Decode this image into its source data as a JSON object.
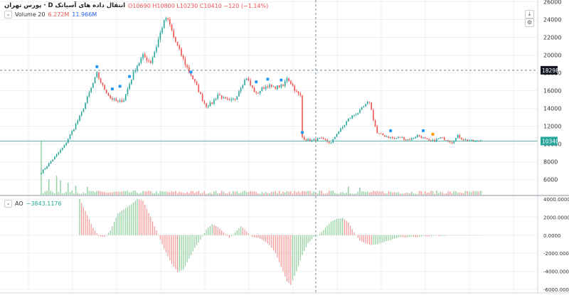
{
  "legend": {
    "title": "پورس تهران · D  انتقال داده های آسیاتک",
    "ohlc": "O10690  H10800  L10230  C10410  −120 (−1.14%)",
    "volume_label": "Volume 20",
    "volume_value": "6.272M",
    "volume_ma": "11.966M",
    "ao_label": "AO",
    "ao_value": "−3843.1176"
  },
  "toolbar": {
    "scroll_icon": "arrow-down-to-line-icon",
    "settings_icon": "settings-icon"
  },
  "colors": {
    "up": "#26a69a",
    "down": "#ef5350",
    "up_vol": "#9fd3ac",
    "down_vol": "#f5a6a6",
    "ao_up": "#8fce9b",
    "ao_down": "#f19595",
    "grid": "#eef0f3",
    "axis_text": "#333333"
  },
  "chart_data": [
    {
      "type": "candlestick",
      "title": "پورس تهران · D  انتقال داده های آسیاتک",
      "y_ticks": [
        6000,
        8000,
        10000,
        12000,
        14000,
        16000,
        18000,
        20000,
        22000,
        24000,
        26000
      ],
      "ylim": [
        4300,
        26200
      ],
      "price_labels": [
        {
          "value": 18298,
          "text": "18298",
          "color": "#131722"
        },
        {
          "value": 10340,
          "text": "10340",
          "color": "#26a69a"
        }
      ],
      "anchors": [
        [
          0,
          6800
        ],
        [
          6,
          8300
        ],
        [
          12,
          9800
        ],
        [
          17,
          11800
        ],
        [
          21,
          13500
        ],
        [
          24,
          15200
        ],
        [
          27,
          16800
        ],
        [
          29,
          17900
        ],
        [
          32,
          16500
        ],
        [
          36,
          15200
        ],
        [
          40,
          14700
        ],
        [
          43,
          15000
        ],
        [
          46,
          16800
        ],
        [
          49,
          18500
        ],
        [
          53,
          19900
        ],
        [
          57,
          19200
        ],
        [
          60,
          21000
        ],
        [
          63,
          23200
        ],
        [
          65,
          24200
        ],
        [
          67,
          23400
        ],
        [
          69,
          22000
        ],
        [
          71,
          21000
        ],
        [
          73,
          20000
        ],
        [
          75,
          19000
        ],
        [
          78,
          17800
        ],
        [
          81,
          16500
        ],
        [
          84,
          15000
        ],
        [
          86,
          14300
        ],
        [
          89,
          14600
        ],
        [
          92,
          15600
        ],
        [
          95,
          15100
        ],
        [
          98,
          14800
        ],
        [
          101,
          15100
        ],
        [
          104,
          16500
        ],
        [
          107,
          17500
        ],
        [
          109,
          16600
        ],
        [
          112,
          15600
        ],
        [
          115,
          16200
        ],
        [
          118,
          16600
        ],
        [
          121,
          16300
        ],
        [
          124,
          16500
        ],
        [
          126,
          16500
        ],
        [
          128,
          17500
        ],
        [
          130,
          16900
        ],
        [
          133,
          15800
        ],
        [
          135,
          15400
        ],
        [
          136,
          10800
        ],
        [
          138,
          10500
        ],
        [
          141,
          10400
        ],
        [
          145,
          10600
        ],
        [
          148,
          10400
        ],
        [
          151,
          10100
        ],
        [
          154,
          11200
        ],
        [
          157,
          11900
        ],
        [
          160,
          12800
        ],
        [
          163,
          13300
        ],
        [
          166,
          13700
        ],
        [
          168,
          14200
        ],
        [
          170,
          14600
        ],
        [
          171,
          14800
        ],
        [
          173,
          12800
        ],
        [
          175,
          11200
        ],
        [
          178,
          11000
        ],
        [
          181,
          10800
        ],
        [
          184,
          10600
        ],
        [
          187,
          10800
        ],
        [
          190,
          10500
        ],
        [
          193,
          10600
        ],
        [
          196,
          11000
        ],
        [
          199,
          10700
        ],
        [
          202,
          10300
        ],
        [
          205,
          10400
        ],
        [
          208,
          10700
        ],
        [
          211,
          10500
        ],
        [
          214,
          10200
        ],
        [
          217,
          10900
        ],
        [
          220,
          10500
        ],
        [
          223,
          10400
        ],
        [
          226,
          10300
        ],
        [
          229,
          10400
        ]
      ],
      "icon_markers": [
        {
          "index": 29,
          "price": 18700,
          "color": "#2196f3"
        },
        {
          "index": 37,
          "price": 16200,
          "color": "#2196f3"
        },
        {
          "index": 41,
          "price": 16500,
          "color": "#2196f3"
        },
        {
          "index": 46,
          "price": 17600,
          "color": "#2196f3"
        },
        {
          "index": 78,
          "price": 18100,
          "color": "#2196f3"
        },
        {
          "index": 112,
          "price": 17000,
          "color": "#2196f3"
        },
        {
          "index": 118,
          "price": 17300,
          "color": "#2196f3"
        },
        {
          "index": 125,
          "price": 17200,
          "color": "#2196f3"
        },
        {
          "index": 136,
          "price": 11300,
          "color": "#2196f3"
        },
        {
          "index": 182,
          "price": 11500,
          "color": "#2196f3"
        },
        {
          "index": 199,
          "price": 11500,
          "color": "#2196f3"
        },
        {
          "index": 204,
          "price": 11100,
          "color": "#ff9800"
        }
      ],
      "grid": true,
      "crosshair": {
        "index": 143,
        "price": 18298
      }
    },
    {
      "type": "bar",
      "title": "Volume 20",
      "spikes": [
        {
          "index": 0,
          "value": 9
        },
        {
          "index": 4,
          "value": 2.6
        },
        {
          "index": 8,
          "value": 3.2
        },
        {
          "index": 10,
          "value": 2.4
        },
        {
          "index": 14,
          "value": 2.0
        },
        {
          "index": 18,
          "value": 1.5
        },
        {
          "index": 24,
          "value": 1.3
        },
        {
          "index": 160,
          "value": 1.4
        },
        {
          "index": 166,
          "value": 1.2
        }
      ]
    },
    {
      "type": "bar",
      "title": "AO",
      "y_ticks": [
        4000,
        2000,
        0,
        -2000,
        -4000,
        -6000
      ],
      "y_tick_labels": [
        "4000.0000",
        "2000.0000",
        "0.0000",
        "-2000.0000",
        "-4000.0000",
        "-6000.0000"
      ],
      "ylim": [
        -6300,
        4300
      ],
      "anchors": [
        [
          20,
          4000
        ],
        [
          24,
          2200
        ],
        [
          27,
          800
        ],
        [
          30,
          -100
        ],
        [
          33,
          -200
        ],
        [
          36,
          500
        ],
        [
          40,
          2400
        ],
        [
          44,
          3000
        ],
        [
          47,
          3400
        ],
        [
          50,
          4000
        ],
        [
          53,
          3800
        ],
        [
          57,
          2000
        ],
        [
          60,
          500
        ],
        [
          64,
          -1500
        ],
        [
          68,
          -3200
        ],
        [
          71,
          -4100
        ],
        [
          74,
          -3800
        ],
        [
          77,
          -2600
        ],
        [
          80,
          -1400
        ],
        [
          83,
          -500
        ],
        [
          86,
          600
        ],
        [
          89,
          1200
        ],
        [
          92,
          900
        ],
        [
          95,
          300
        ],
        [
          98,
          -300
        ],
        [
          101,
          300
        ],
        [
          104,
          1000
        ],
        [
          107,
          400
        ],
        [
          110,
          -200
        ],
        [
          113,
          -300
        ],
        [
          116,
          -600
        ],
        [
          119,
          -1100
        ],
        [
          122,
          -2000
        ],
        [
          125,
          -3500
        ],
        [
          128,
          -5100
        ],
        [
          130,
          -5500
        ],
        [
          133,
          -4000
        ],
        [
          136,
          -2200
        ],
        [
          139,
          -900
        ],
        [
          142,
          -200
        ],
        [
          145,
          100
        ],
        [
          148,
          800
        ],
        [
          151,
          1500
        ],
        [
          154,
          1800
        ],
        [
          157,
          1900
        ],
        [
          160,
          1400
        ],
        [
          163,
          300
        ],
        [
          166,
          -600
        ],
        [
          169,
          -900
        ],
        [
          172,
          -1100
        ],
        [
          175,
          -1000
        ],
        [
          178,
          -800
        ],
        [
          181,
          -600
        ],
        [
          184,
          -400
        ],
        [
          187,
          -200
        ],
        [
          190,
          -300
        ],
        [
          193,
          -150
        ],
        [
          196,
          -250
        ],
        [
          199,
          -100
        ],
        [
          202,
          -150
        ],
        [
          205,
          -50
        ],
        [
          208,
          -100
        ],
        [
          211,
          -50
        ],
        [
          214,
          0
        ],
        [
          217,
          0
        ],
        [
          220,
          0
        ],
        [
          223,
          0
        ],
        [
          226,
          0
        ],
        [
          229,
          0
        ]
      ],
      "grid": true,
      "crosshair": {
        "index": 143
      }
    }
  ]
}
